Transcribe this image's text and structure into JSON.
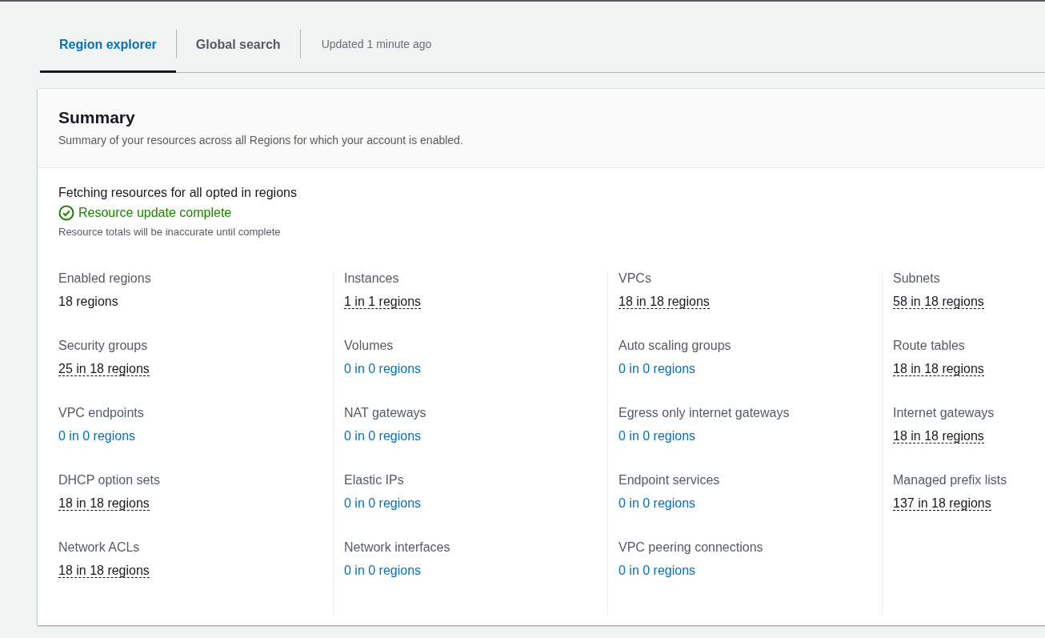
{
  "tabs": [
    {
      "label": "Region explorer",
      "selected": true
    },
    {
      "label": "Global search",
      "selected": false
    }
  ],
  "updated": "Updated 1 minute ago",
  "summary": {
    "title": "Summary",
    "description": "Summary of your resources across all Regions for which your account is enabled.",
    "fetch_heading": "Fetching resources for all opted in regions",
    "status": "Resource update complete",
    "status_note": "Resource totals will be inaccurate until complete",
    "columns": [
      {
        "items": [
          {
            "label": "Enabled regions",
            "value": "18 regions",
            "kind": "plain"
          },
          {
            "label": "Security groups",
            "value": "25 in 18 regions",
            "kind": "popover"
          },
          {
            "label": "VPC endpoints",
            "value": "0 in 0 regions",
            "kind": "link"
          },
          {
            "label": "DHCP option sets",
            "value": "18 in 18 regions",
            "kind": "popover"
          },
          {
            "label": "Network ACLs",
            "value": "18 in 18 regions",
            "kind": "popover"
          }
        ]
      },
      {
        "items": [
          {
            "label": "Instances",
            "value": "1 in 1 regions",
            "kind": "popover"
          },
          {
            "label": "Volumes",
            "value": "0 in 0 regions",
            "kind": "link"
          },
          {
            "label": "NAT gateways",
            "value": "0 in 0 regions",
            "kind": "link"
          },
          {
            "label": "Elastic IPs",
            "value": "0 in 0 regions",
            "kind": "link"
          },
          {
            "label": "Network interfaces",
            "value": "0 in 0 regions",
            "kind": "link"
          }
        ]
      },
      {
        "items": [
          {
            "label": "VPCs",
            "value": "18 in 18 regions",
            "kind": "popover"
          },
          {
            "label": "Auto scaling groups",
            "value": "0 in 0 regions",
            "kind": "link"
          },
          {
            "label": "Egress only internet gateways",
            "value": "0 in 0 regions",
            "kind": "link"
          },
          {
            "label": "Endpoint services",
            "value": "0 in 0 regions",
            "kind": "link"
          },
          {
            "label": "VPC peering connections",
            "value": "0 in 0 regions",
            "kind": "link"
          }
        ]
      },
      {
        "items": [
          {
            "label": "Subnets",
            "value": "58 in 18 regions",
            "kind": "popover"
          },
          {
            "label": "Route tables",
            "value": "18 in 18 regions",
            "kind": "popover"
          },
          {
            "label": "Internet gateways",
            "value": "18 in 18 regions",
            "kind": "popover"
          },
          {
            "label": "Managed prefix lists",
            "value": "137 in 18 regions",
            "kind": "popover"
          }
        ]
      }
    ]
  }
}
